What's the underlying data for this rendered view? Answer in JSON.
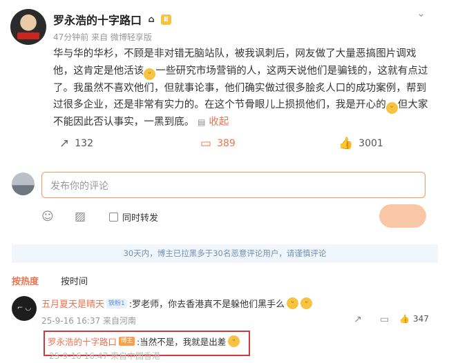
{
  "post": {
    "author": "罗永浩的十字路口",
    "level_badge": "Ⅱ",
    "meta": "47分钟前 来自 微博轻享版",
    "text_1": "华与华的华杉，不顾是非对错无脑站队，被我讽刺后，网友做了大量恶搞图片调戏他，这肯定是他活该",
    "text_2": "一些研究市场营销的人，这两天说他们是骗钱的，这就有点过了。我虽然不喜欢他们，但就事论事，他们确实做过很多脍炙人口的成功案例，帮到过很多企业，还是非常有实力的。在这个节骨眼儿上损损他们，我是开心的",
    "text_3": "但大家不能因此否认事实，一黑到底。",
    "collapse_label": "收起",
    "repost_count": "132",
    "comment_count": "389",
    "like_count": "3001"
  },
  "composer": {
    "placeholder": "发布你的评论",
    "repost_label": "同时转发"
  },
  "notice": "30天内，博主已拉黑多于30名恶意评论用户，请谨慎评论",
  "sort": {
    "hot": "按热度",
    "time": "按时间"
  },
  "comment": {
    "user": "五月夏天是晴天",
    "fan_badge": "铁粉1",
    "text": ":罗老师，你去香港真不是躲他们黑手么",
    "meta": "25-9-16 16:37 来自河南",
    "likes": "347"
  },
  "reply": {
    "user": "罗永浩的十字路口",
    "badge": "博主",
    "text": ":当然不是，我就是出差",
    "meta": "25-9-16 16:47 来自中国香港"
  },
  "colors": {
    "accent": "#eb7350",
    "notice_bg": "#f0f6fc",
    "highlight_border": "#d23a35"
  },
  "icons": [
    "chevron-down-icon",
    "home-icon",
    "repost-icon",
    "comment-icon",
    "like-icon",
    "emoji-icon",
    "image-icon",
    "share-icon"
  ]
}
